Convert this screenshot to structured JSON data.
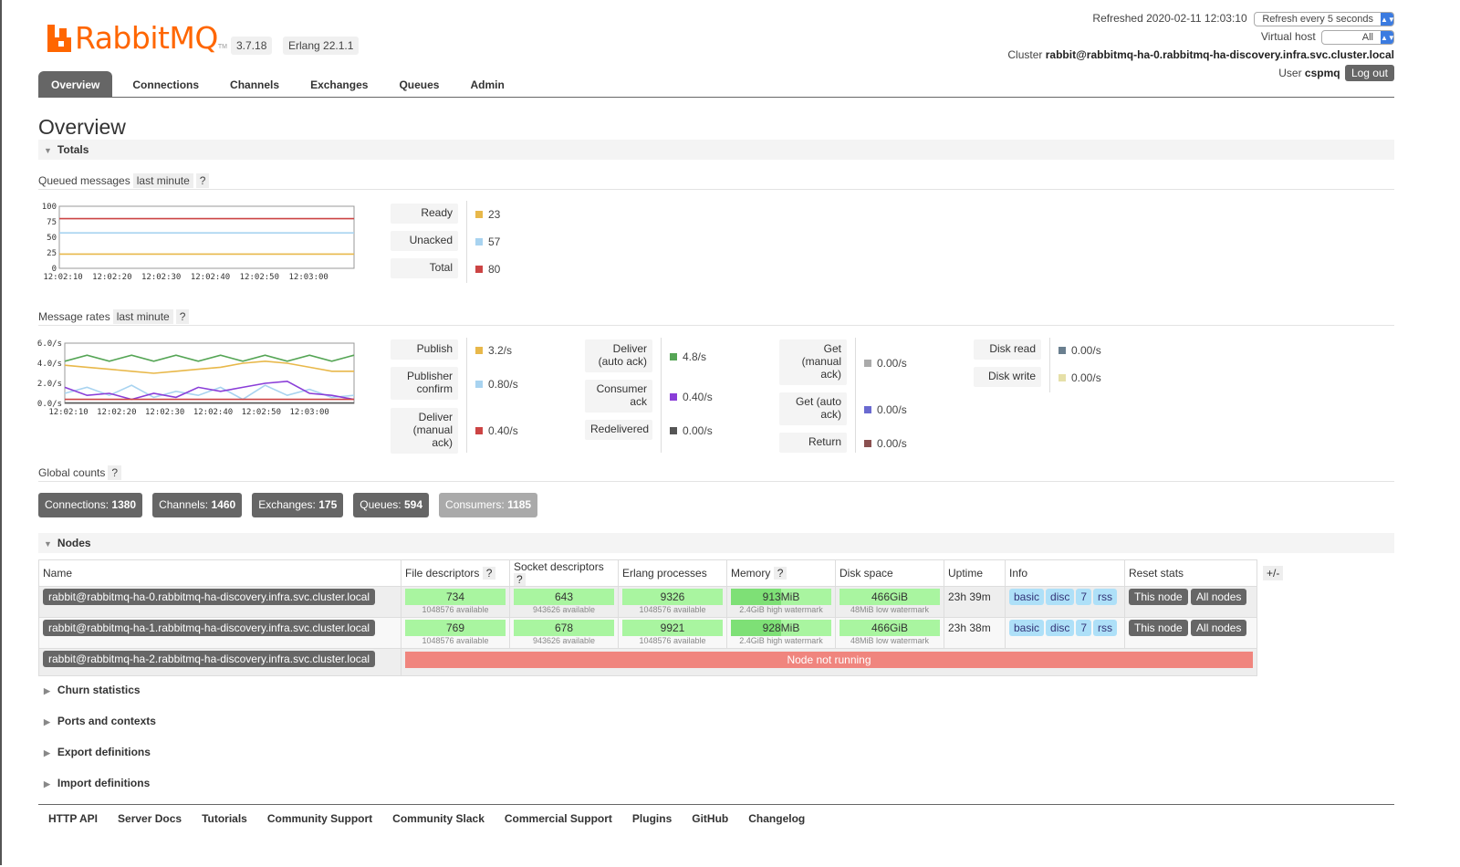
{
  "app": {
    "logo_text": "RabbitMQ",
    "logo_tm": "TM",
    "version": "3.7.18",
    "erlang": "Erlang 22.1.1"
  },
  "header": {
    "refreshed_label": "Refreshed 2020-02-11 12:03:10",
    "refresh_select": "Refresh every 5 seconds",
    "vhost_label": "Virtual host",
    "vhost_select": "All",
    "cluster_label": "Cluster",
    "cluster_name": "rabbit@rabbitmq-ha-0.rabbitmq-ha-discovery.infra.svc.cluster.local",
    "user_label": "User",
    "user_name": "cspmq",
    "logout": "Log out"
  },
  "tabs": [
    "Overview",
    "Connections",
    "Channels",
    "Exchanges",
    "Queues",
    "Admin"
  ],
  "page_title": "Overview",
  "totals": {
    "section_title": "Totals",
    "queued_label": "Queued messages",
    "queued_range": "last minute",
    "help": "?",
    "rates_label": "Message rates",
    "rates_range": "last minute",
    "queued_stats": [
      {
        "label": "Ready",
        "value": "23",
        "color": "#e8b84a"
      },
      {
        "label": "Unacked",
        "value": "57",
        "color": "#a8d3f0"
      },
      {
        "label": "Total",
        "value": "80",
        "color": "#cc4444"
      }
    ],
    "rate_stats": {
      "col1": [
        {
          "label": "Publish",
          "value": "3.2/s",
          "color": "#e8b84a"
        },
        {
          "label": "Publisher confirm",
          "value": "0.80/s",
          "color": "#a8d3f0"
        },
        {
          "label": "Deliver (manual ack)",
          "value": "0.40/s",
          "color": "#cc4444"
        }
      ],
      "col2": [
        {
          "label": "Deliver (auto ack)",
          "value": "4.8/s",
          "color": "#55a555"
        },
        {
          "label": "Consumer ack",
          "value": "0.40/s",
          "color": "#8a3ed8"
        },
        {
          "label": "Redelivered",
          "value": "0.00/s",
          "color": "#555555"
        }
      ],
      "col3": [
        {
          "label": "Get (manual ack)",
          "value": "0.00/s",
          "color": "#aaaaaa"
        },
        {
          "label": "Get (auto ack)",
          "value": "0.00/s",
          "color": "#6a6ad0"
        },
        {
          "label": "Return",
          "value": "0.00/s",
          "color": "#8a5050"
        }
      ],
      "col4": [
        {
          "label": "Disk read",
          "value": "0.00/s",
          "color": "#6a7f8f"
        },
        {
          "label": "Disk write",
          "value": "0.00/s",
          "color": "#e6e0a8"
        }
      ]
    },
    "global_label": "Global counts",
    "global_counts": [
      {
        "label": "Connections:",
        "value": "1380"
      },
      {
        "label": "Channels:",
        "value": "1460"
      },
      {
        "label": "Exchanges:",
        "value": "175"
      },
      {
        "label": "Queues:",
        "value": "594"
      },
      {
        "label": "Consumers:",
        "value": "1185"
      }
    ]
  },
  "chart_data": [
    {
      "type": "line",
      "title": "Queued messages",
      "x": [
        "12:02:10",
        "12:02:20",
        "12:02:30",
        "12:02:40",
        "12:02:50",
        "12:03:00"
      ],
      "ylim": [
        0,
        100
      ],
      "yticks": [
        "100",
        "75",
        "50",
        "25",
        "0"
      ],
      "series": [
        {
          "name": "Total",
          "color": "#cc4444",
          "values": [
            80,
            80,
            80,
            80,
            80,
            80,
            80
          ]
        },
        {
          "name": "Unacked",
          "color": "#a8d3f0",
          "values": [
            57,
            57,
            57,
            57,
            57,
            57,
            57
          ]
        },
        {
          "name": "Ready",
          "color": "#e8b84a",
          "values": [
            23,
            23,
            23,
            23,
            23,
            23,
            23
          ]
        }
      ]
    },
    {
      "type": "line",
      "title": "Message rates",
      "x": [
        "12:02:10",
        "12:02:20",
        "12:02:30",
        "12:02:40",
        "12:02:50",
        "12:03:00"
      ],
      "ylim": [
        0,
        6
      ],
      "yticks": [
        "6.0/s",
        "4.0/s",
        "2.0/s",
        "0.0/s"
      ],
      "series": [
        {
          "name": "Deliver (auto ack)",
          "color": "#55a555",
          "values": [
            4.2,
            4.8,
            4.2,
            4.8,
            4.2,
            4.8,
            4.2,
            4.8,
            4.2,
            4.8,
            4.2,
            4.8,
            4.2,
            4.8
          ]
        },
        {
          "name": "Publish",
          "color": "#e8b84a",
          "values": [
            3.8,
            3.6,
            3.4,
            3.2,
            3.0,
            3.2,
            3.4,
            3.6,
            4.0,
            4.2,
            4.0,
            3.6,
            3.2,
            3.2
          ]
        },
        {
          "name": "Publisher confirm",
          "color": "#a8d3f0",
          "values": [
            1.0,
            1.6,
            0.8,
            1.8,
            0.6,
            1.2,
            0.8,
            1.6,
            0.4,
            1.8,
            0.8,
            1.4,
            0.6,
            0.8
          ]
        },
        {
          "name": "Consumer ack",
          "color": "#8a3ed8",
          "values": [
            1.6,
            0.8,
            1.0,
            0.4,
            1.0,
            0.6,
            1.6,
            1.2,
            1.6,
            2.0,
            2.2,
            1.0,
            0.8,
            0.4
          ]
        },
        {
          "name": "Deliver (manual ack)",
          "color": "#cc4444",
          "values": [
            0.4,
            0.4,
            0.4,
            0.4,
            0.4,
            0.4,
            0.4,
            0.4,
            0.4,
            0.4,
            0.4,
            0.4,
            0.4,
            0.4
          ]
        },
        {
          "name": "Redelivered",
          "color": "#555555",
          "values": [
            0.05,
            0.05,
            0.05,
            0.05,
            0.05,
            0.05,
            0.05,
            0.05,
            0.05,
            0.05,
            0.05,
            0.05,
            0.05,
            0.05
          ]
        }
      ]
    }
  ],
  "nodes": {
    "section_title": "Nodes",
    "plus_minus": "+/-",
    "columns": [
      "Name",
      "File descriptors",
      "Socket descriptors",
      "Erlang processes",
      "Memory",
      "Disk space",
      "Uptime",
      "Info",
      "Reset stats"
    ],
    "rows": [
      {
        "name": "rabbit@rabbitmq-ha-0.rabbitmq-ha-discovery.infra.svc.cluster.local",
        "fd": "734",
        "fd_avail": "1048576 available",
        "sd": "643",
        "sd_avail": "943626 available",
        "ep": "9326",
        "ep_avail": "1048576 available",
        "mem": "913MiB",
        "mem_wm": "2.4GiB high watermark",
        "disk": "466GiB",
        "disk_wm": "48MiB low watermark",
        "uptime": "23h 39m",
        "info": [
          "basic",
          "disc",
          "7",
          "rss"
        ],
        "reset": [
          "This node",
          "All nodes"
        ]
      },
      {
        "name": "rabbit@rabbitmq-ha-1.rabbitmq-ha-discovery.infra.svc.cluster.local",
        "fd": "769",
        "fd_avail": "1048576 available",
        "sd": "678",
        "sd_avail": "943626 available",
        "ep": "9921",
        "ep_avail": "1048576 available",
        "mem": "928MiB",
        "mem_wm": "2.4GiB high watermark",
        "disk": "466GiB",
        "disk_wm": "48MiB low watermark",
        "uptime": "23h 38m",
        "info": [
          "basic",
          "disc",
          "7",
          "rss"
        ],
        "reset": [
          "This node",
          "All nodes"
        ]
      },
      {
        "name": "rabbit@rabbitmq-ha-2.rabbitmq-ha-discovery.infra.svc.cluster.local",
        "status": "Node not running"
      }
    ]
  },
  "collapsed_sections": [
    "Churn statistics",
    "Ports and contexts",
    "Export definitions",
    "Import definitions"
  ],
  "footer": [
    "HTTP API",
    "Server Docs",
    "Tutorials",
    "Community Support",
    "Community Slack",
    "Commercial Support",
    "Plugins",
    "GitHub",
    "Changelog"
  ]
}
